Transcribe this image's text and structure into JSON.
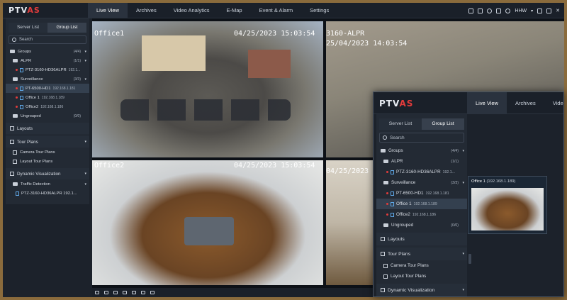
{
  "app": {
    "logo": {
      "main": "PTV",
      "accent": "AS"
    },
    "nav_tabs": [
      "Live View",
      "Archives",
      "Video Analytics",
      "E-Map",
      "Event & Alarm",
      "Settings"
    ],
    "user": "HHW"
  },
  "sidebar": {
    "tabs": [
      "Server List",
      "Group List"
    ],
    "search_placeholder": "Search",
    "groups": {
      "label": "Groups",
      "count": "(4/4)"
    },
    "alpr": {
      "label": "ALPR",
      "count": "(1/1)"
    },
    "alpr_cam": {
      "label": "PTZ-3160-HD36ALPR",
      "ip": "192.1..."
    },
    "surveillance": {
      "label": "Surveillance",
      "count": "(3/3)"
    },
    "cams": [
      {
        "label": "PT-6500-HD1",
        "ip": "192.168.1.181"
      },
      {
        "label": "Office 1",
        "ip": "192.168.1.189"
      },
      {
        "label": "Office2",
        "ip": "192.168.1.186"
      }
    ],
    "ungrouped": {
      "label": "Ungrouped",
      "count": "(0/0)"
    },
    "layouts": "Layouts",
    "tour_plans": "Tour Plans",
    "camera_tour": "Camera Tour Plans",
    "layout_tour": "Layout Tour Plans",
    "dynamic_vis": "Dynamic Visualization",
    "traffic": "Traffic Detection",
    "traffic_cam": "PTZ-3160-HD36ALPR 192.1..."
  },
  "tiles": [
    {
      "label": "Office1",
      "timestamp": "04/25/2023  15:03:54"
    },
    {
      "label": "3160-ALPR",
      "timestamp": "25/04/2023  14:03:54"
    },
    {
      "label": "Office2",
      "timestamp": "04/25/2023  15:03:54"
    },
    {
      "label": "",
      "timestamp": "04/25/2023"
    }
  ],
  "overlay": {
    "nav_tabs": [
      "Live View",
      "Archives",
      "Video A"
    ],
    "preview": {
      "title": "Office 1",
      "ip": "(192.168.1.189)"
    }
  },
  "colors": {
    "brand_red": "#e23b3b",
    "bg": "#1c222b",
    "panel": "#232a34",
    "selected": "#34404f",
    "camera_icon": "#5fa8e8"
  }
}
